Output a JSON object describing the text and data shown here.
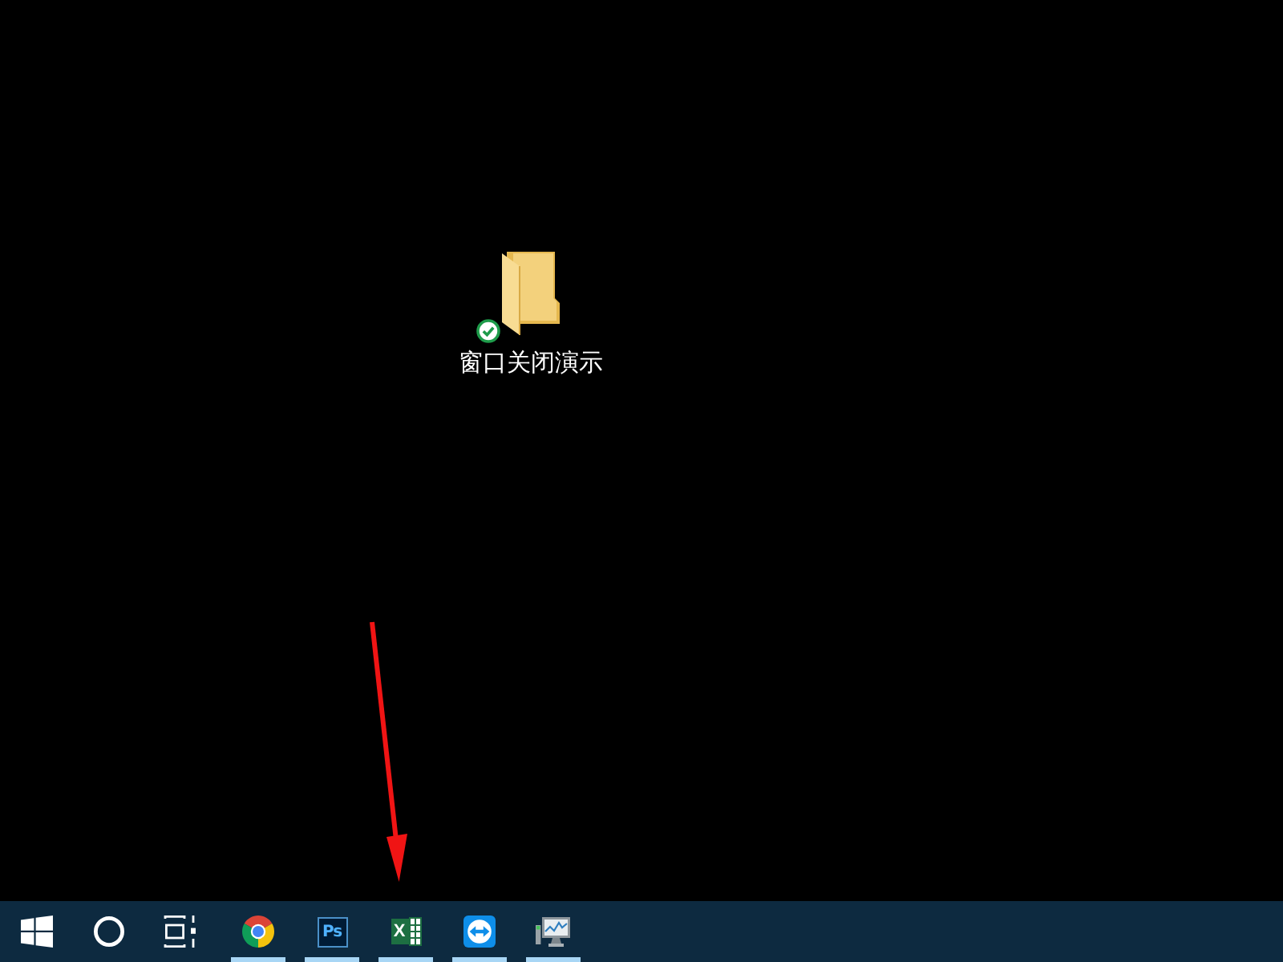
{
  "desktop": {
    "icons": [
      {
        "label": "窗口关闭演示",
        "synced": true
      }
    ]
  },
  "taskbar": {
    "apps": [
      {
        "kind": "browser",
        "running": true
      },
      {
        "kind": "image-editor",
        "label": "Ps",
        "running": true
      },
      {
        "kind": "spreadsheet",
        "label": "X",
        "running": true
      },
      {
        "kind": "remote-control",
        "running": true
      },
      {
        "kind": "monitor",
        "running": true
      }
    ]
  }
}
